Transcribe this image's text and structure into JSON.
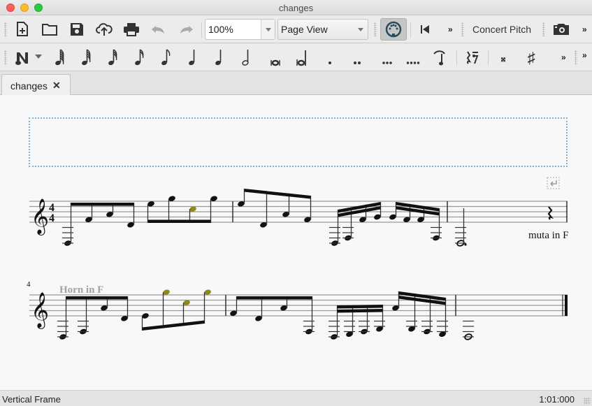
{
  "window": {
    "title": "changes"
  },
  "toolbar_main": {
    "buttons": [
      {
        "name": "new-score",
        "icon": "new-file-icon"
      },
      {
        "name": "open",
        "icon": "folder-icon"
      },
      {
        "name": "save",
        "icon": "save-icon"
      },
      {
        "name": "upload",
        "icon": "cloud-upload-icon"
      },
      {
        "name": "print",
        "icon": "printer-icon"
      },
      {
        "name": "undo",
        "icon": "undo-icon",
        "disabled": true
      },
      {
        "name": "redo",
        "icon": "redo-icon",
        "disabled": true
      }
    ],
    "zoom_value": "100%",
    "view_mode": "Page View",
    "midi_input_active": true,
    "rewind_icon": "rewind-to-start-icon",
    "overflow_label": "»",
    "concert_pitch_label": "Concert Pitch",
    "image_capture_icon": "camera-icon"
  },
  "toolbar_notes": {
    "note_input_icon": "note-input-N-icon",
    "durations": [
      {
        "name": "128th",
        "icon": "128th-note-icon"
      },
      {
        "name": "64th",
        "icon": "64th-note-icon"
      },
      {
        "name": "32nd",
        "icon": "32nd-note-icon"
      },
      {
        "name": "16th",
        "icon": "16th-note-icon"
      },
      {
        "name": "eighth",
        "icon": "eighth-note-icon"
      },
      {
        "name": "quarter",
        "icon": "quarter-note-icon"
      },
      {
        "name": "half",
        "icon": "half-note-icon"
      },
      {
        "name": "whole",
        "icon": "whole-note-icon"
      },
      {
        "name": "breve",
        "icon": "breve-icon"
      },
      {
        "name": "longa",
        "icon": "longa-icon"
      }
    ],
    "dots": [
      {
        "name": "augmentation-dot",
        "label": "."
      },
      {
        "name": "double-dot",
        "label": ".."
      },
      {
        "name": "triple-dot",
        "label": "..."
      },
      {
        "name": "quadruple-dot",
        "label": "...."
      }
    ],
    "tie_icon": "tie-icon",
    "rest_toggle_icon": "rest-icon",
    "double_sharp_label": "𝄪",
    "sharp_label": "♯",
    "overflow_label": "»"
  },
  "tabs": [
    {
      "label": "changes",
      "close_label": "✕",
      "active": true
    }
  ],
  "score": {
    "system2_measure_number": "4",
    "staff_text_muta": "muta in F",
    "instrument_change_text": "Horn in F",
    "highlight_color": "#8b8a1a",
    "frame_border_color": "#7fb3d0"
  },
  "status": {
    "selection": "Vertical Frame",
    "position": "1:01:000"
  }
}
